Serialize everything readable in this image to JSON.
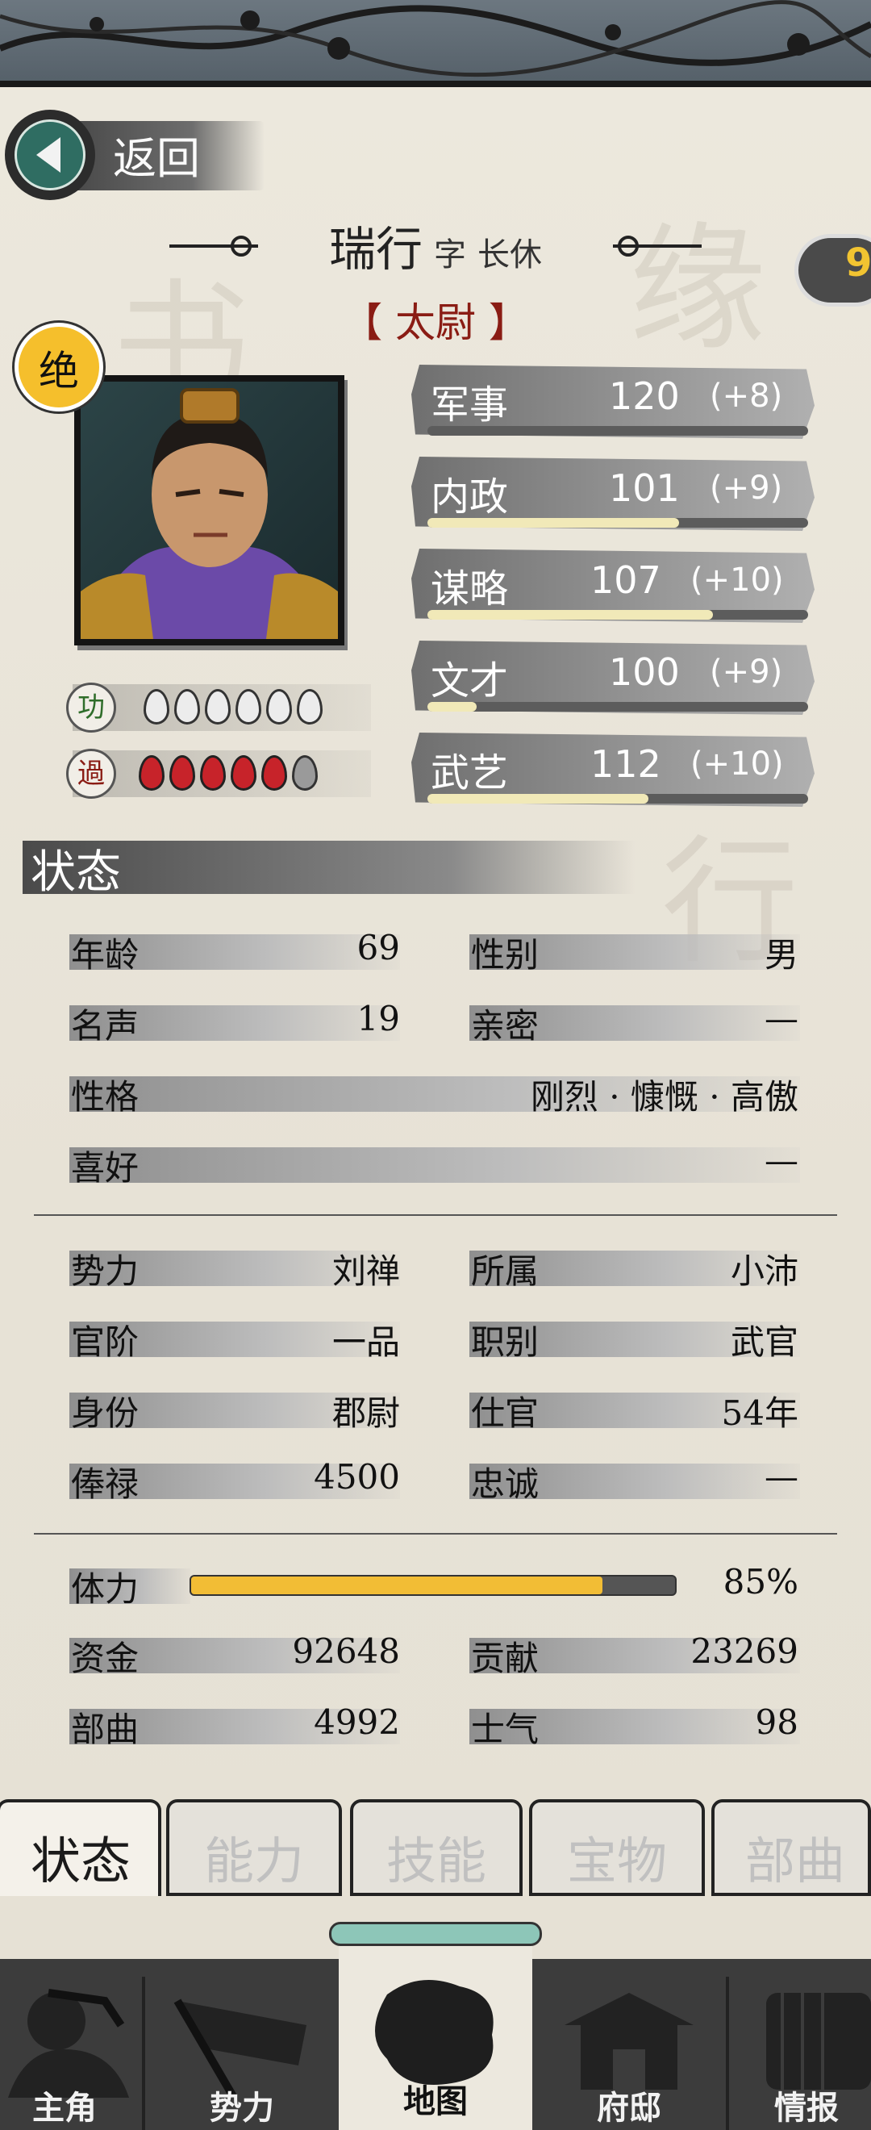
{
  "header": {
    "back_label": "返回",
    "cloud_number": "9"
  },
  "character": {
    "name": "瑞行",
    "courtesy_prefix": "字",
    "courtesy_name": "长休",
    "title_display": "【 太尉 】",
    "rank_badge": "绝",
    "merit_label": "功",
    "fault_label": "過",
    "merit_count": 6,
    "fault_count": 5
  },
  "stats": [
    {
      "label": "军事",
      "value": "120",
      "bonus": "(+8)",
      "fill": 0.0
    },
    {
      "label": "内政",
      "value": "101",
      "bonus": "(+9)",
      "fill": 0.66
    },
    {
      "label": "谋略",
      "value": "107",
      "bonus": "(+10)",
      "fill": 0.75
    },
    {
      "label": "文才",
      "value": "100",
      "bonus": "(+9)",
      "fill": 0.13
    },
    {
      "label": "武艺",
      "value": "112",
      "bonus": "(+10)",
      "fill": 0.58
    }
  ],
  "status_section": {
    "title": "状态",
    "age_label": "年龄",
    "age_value": "69",
    "gender_label": "性别",
    "gender_value": "男",
    "fame_label": "名声",
    "fame_value": "19",
    "intimacy_label": "亲密",
    "intimacy_value": "—",
    "personality_label": "性格",
    "personality_value": "刚烈 · 慷慨 · 高傲",
    "hobby_label": "喜好",
    "hobby_value": "—",
    "faction_label": "势力",
    "faction_value": "刘禅",
    "belong_label": "所属",
    "belong_value": "小沛",
    "rank_label": "官阶",
    "rank_value": "一品",
    "post_label": "职别",
    "post_value": "武官",
    "identity_label": "身份",
    "identity_value": "郡尉",
    "service_label": "仕官",
    "service_value": "54年",
    "salary_label": "俸禄",
    "salary_value": "4500",
    "loyalty_label": "忠诚",
    "loyalty_value": "—",
    "stamina_label": "体力",
    "stamina_value": "85%",
    "stamina_fill": 0.85,
    "funds_label": "资金",
    "funds_value": "92648",
    "contribution_label": "贡献",
    "contribution_value": "23269",
    "troops_label": "部曲",
    "troops_value": "4992",
    "morale_label": "士气",
    "morale_value": "98"
  },
  "tabs": [
    {
      "label": "状态",
      "active": true
    },
    {
      "label": "能力",
      "active": false
    },
    {
      "label": "技能",
      "active": false
    },
    {
      "label": "宝物",
      "active": false
    },
    {
      "label": "部曲",
      "active": false
    }
  ],
  "nav": [
    {
      "label": "主角",
      "icon": "warrior-icon"
    },
    {
      "label": "势力",
      "icon": "flag-icon"
    },
    {
      "label": "地图",
      "icon": "map-icon",
      "active": true
    },
    {
      "label": "府邸",
      "icon": "mansion-icon"
    },
    {
      "label": "情报",
      "icon": "scroll-icon"
    }
  ],
  "colors": {
    "title_red": "#8a1c14",
    "stamina": "#f2bd35",
    "badge": "#f5bf2c"
  }
}
